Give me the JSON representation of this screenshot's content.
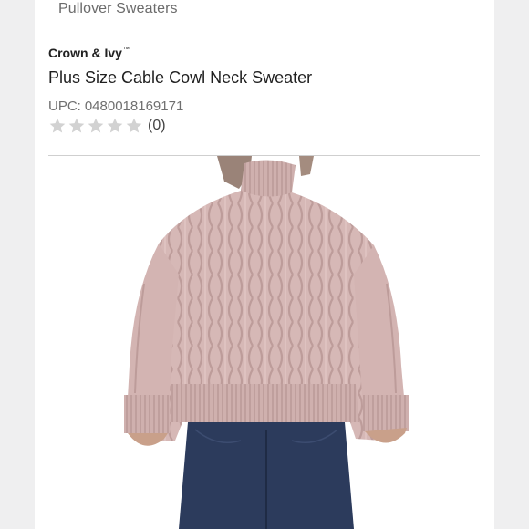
{
  "breadcrumb": {
    "label": "Pullover Sweaters"
  },
  "product": {
    "brand": "Crown & Ivy",
    "brand_mark": "™",
    "title": "Plus Size Cable Cowl Neck Sweater",
    "upc_label": "UPC:",
    "upc_value": "0480018169171",
    "rating": {
      "stars_filled": 0,
      "stars_total": 5,
      "review_count": "(0)"
    }
  },
  "image": {
    "subject": "model wearing blush pink cable knit mock neck sweater with dark jeans",
    "sweater_color": "#d8bab8",
    "jeans_color": "#2c3b5c"
  },
  "colors": {
    "star_empty": "#d2d2d2",
    "divider": "#cfcfcf",
    "page_background": "#ffffff",
    "outer_background": "#efeff0"
  }
}
